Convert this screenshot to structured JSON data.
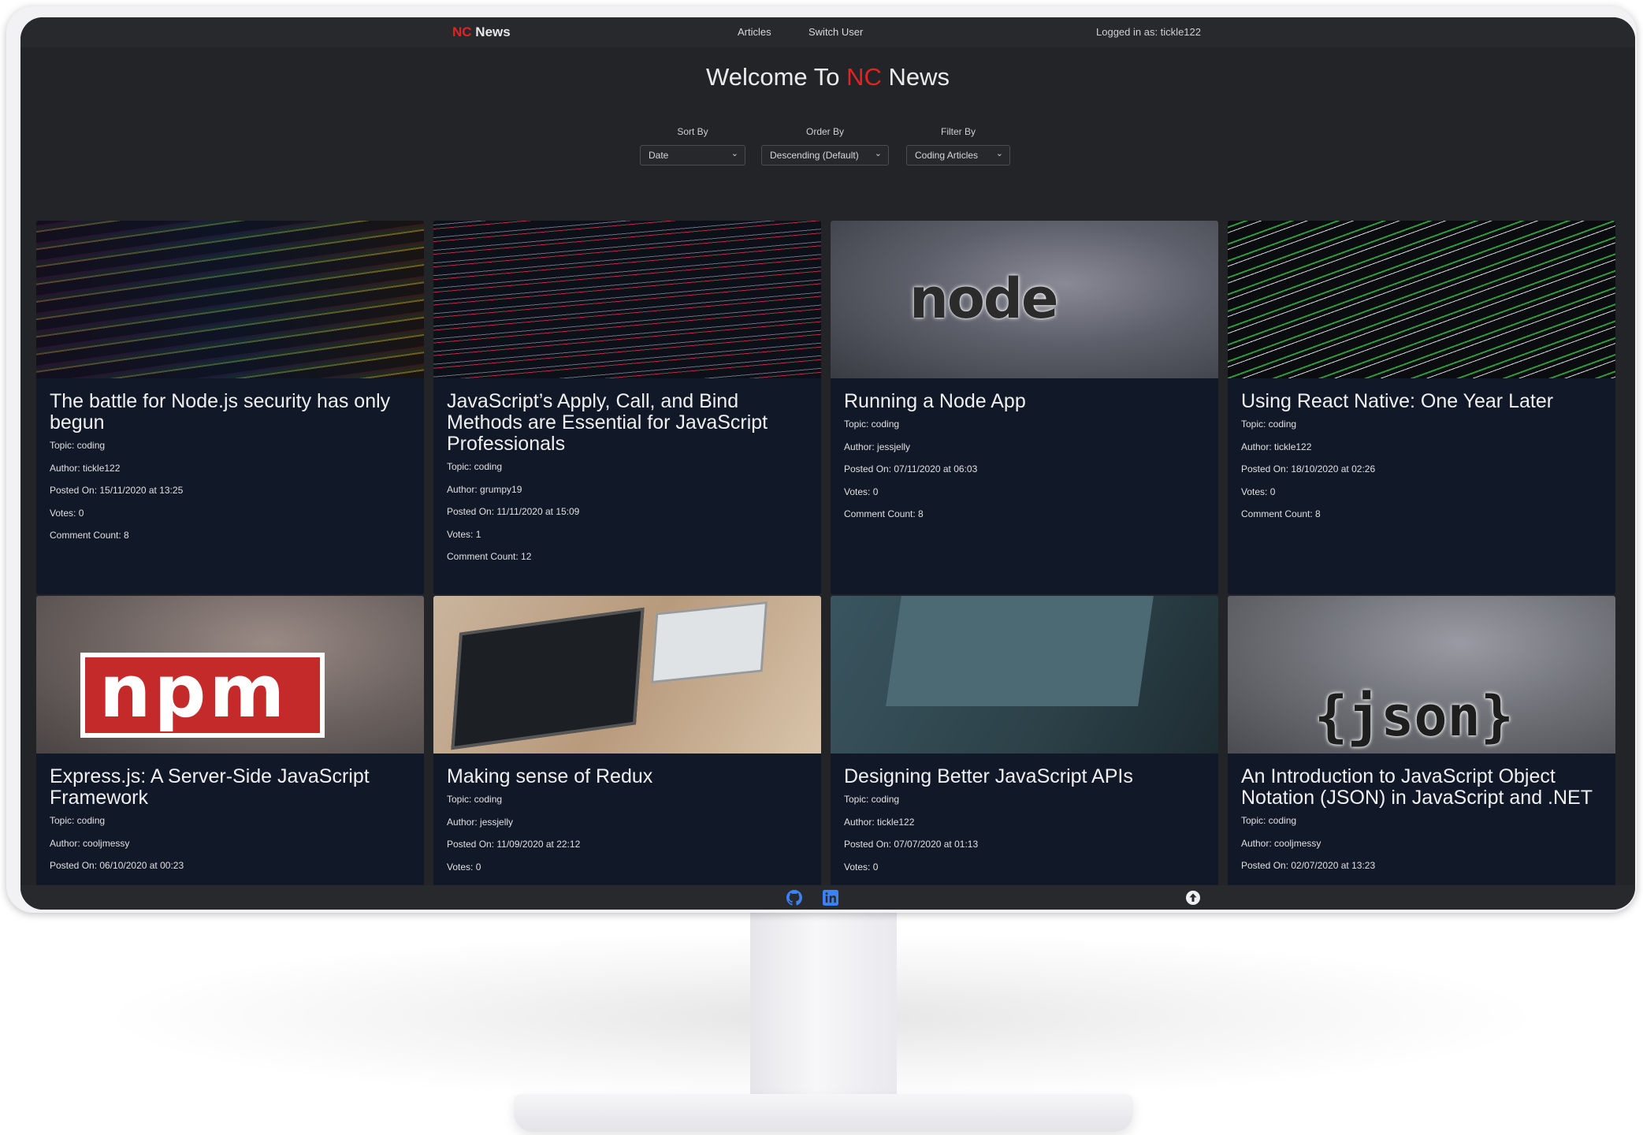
{
  "navbar": {
    "brand_nc": "NC",
    "brand_news": " News",
    "links": [
      "Articles",
      "Switch User"
    ],
    "logged_in": "Logged in as: tickle122"
  },
  "welcome": {
    "prefix": "Welcome To ",
    "nc": "NC",
    "suffix": " News"
  },
  "filters": {
    "sort": {
      "label": "Sort By",
      "value": "Date"
    },
    "order": {
      "label": "Order By",
      "value": "Descending (Default)"
    },
    "filter": {
      "label": "Filter By",
      "value": "Coding Articles"
    }
  },
  "articles": [
    {
      "title": "The battle for Node.js security has only begun",
      "topic": "Topic: coding",
      "author": "Author: tickle122",
      "posted": "Posted On: 15/11/2020 at 13:25",
      "votes": "Votes: 0",
      "comments": "Comment Count: 8"
    },
    {
      "title": "JavaScript’s Apply, Call, and Bind Methods are Essential for JavaScript Professionals",
      "topic": "Topic: coding",
      "author": "Author: grumpy19",
      "posted": "Posted On: 11/11/2020 at 15:09",
      "votes": "Votes: 1",
      "comments": "Comment Count: 12"
    },
    {
      "title": "Running a Node App",
      "topic": "Topic: coding",
      "author": "Author: jessjelly",
      "posted": "Posted On: 07/11/2020 at 06:03",
      "votes": "Votes: 0",
      "comments": "Comment Count: 8"
    },
    {
      "title": "Using React Native: One Year Later",
      "topic": "Topic: coding",
      "author": "Author: tickle122",
      "posted": "Posted On: 18/10/2020 at 02:26",
      "votes": "Votes: 0",
      "comments": "Comment Count: 8"
    },
    {
      "title": "Express.js: A Server-Side JavaScript Framework",
      "topic": "Topic: coding",
      "author": "Author: cooljmessy",
      "posted": "Posted On: 06/10/2020 at 00:23"
    },
    {
      "title": "Making sense of Redux",
      "topic": "Topic: coding",
      "author": "Author: jessjelly",
      "posted": "Posted On: 11/09/2020 at 22:12",
      "votes": "Votes: 0"
    },
    {
      "title": "Designing Better JavaScript APIs",
      "topic": "Topic: coding",
      "author": "Author: tickle122",
      "posted": "Posted On: 07/07/2020 at 01:13",
      "votes": "Votes: 0"
    },
    {
      "title": "An Introduction to JavaScript Object Notation (JSON) in JavaScript and .NET",
      "topic": "Topic: coding",
      "author": "Author: cooljmessy",
      "posted": "Posted On: 02/07/2020 at 13:23"
    }
  ],
  "image_logos": {
    "node": "node",
    "npm": "npm",
    "json": "{json}"
  },
  "footer_icons": [
    "github-icon",
    "linkedin-icon",
    "arrow-up-circle-icon"
  ],
  "colors": {
    "accent_red": "#e02424",
    "card_bg": "#111827",
    "page_bg": "#222428"
  }
}
